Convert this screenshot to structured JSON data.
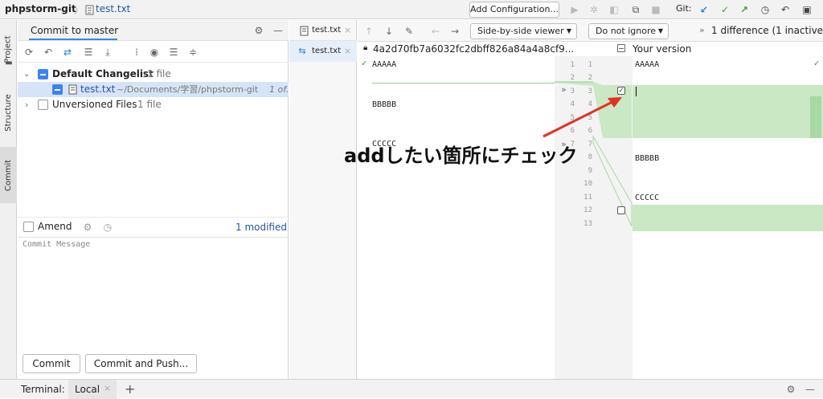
{
  "navbar": {
    "project": "phpstorm-git",
    "file": "test.txt",
    "add_config": "Add Configuration...",
    "git_label": "Git:"
  },
  "stripe": {
    "project": "Project",
    "structure": "Structure",
    "commit": "Commit"
  },
  "commit_panel": {
    "tab_title": "Commit to master",
    "changelist_name": "Default Changelist",
    "changelist_count": "1 file",
    "file_name": "test.txt",
    "file_path": "~/Documents/学習/phpstorm-git",
    "file_suffix": "1 of.",
    "unversioned_label": "Unversioned Files",
    "unversioned_count": "1 file",
    "amend_label": "Amend",
    "modified_label": "1 modified",
    "message_placeholder": "Commit Message",
    "commit_button": "Commit",
    "commit_push_button": "Commit and Push..."
  },
  "file_tabs": [
    {
      "label": "test.txt"
    },
    {
      "label": "test.txt"
    }
  ],
  "diff": {
    "viewer_select": "Side-by-side viewer",
    "ignore_select": "Do not ignore",
    "status": "1 difference (1 inactive)",
    "left_title": "4a2d70fb7a6032fc2dbff826a84a4a8cf9...",
    "right_title": "Your version",
    "left_numbers": [
      "1",
      "2",
      "3",
      "4",
      "5",
      "6",
      "7"
    ],
    "right_numbers": [
      "1",
      "2",
      "3",
      "4",
      "5",
      "6",
      "7",
      "8",
      "9",
      "10",
      "11",
      "12",
      "13"
    ],
    "left_lines": [
      "AAAAA",
      "BBBBB",
      "CCCCC"
    ],
    "right_lines": [
      "AAAAA",
      "BBBBB",
      "CCCCC"
    ]
  },
  "annotation": "addしたい箇所にチェック",
  "bottombar": {
    "terminal_label": "Terminal:",
    "local_tab": "Local"
  },
  "colors": {
    "accent_blue": "#3b82f6",
    "diff_green": "#c9e8c3",
    "arrow_red": "#e0331f"
  }
}
